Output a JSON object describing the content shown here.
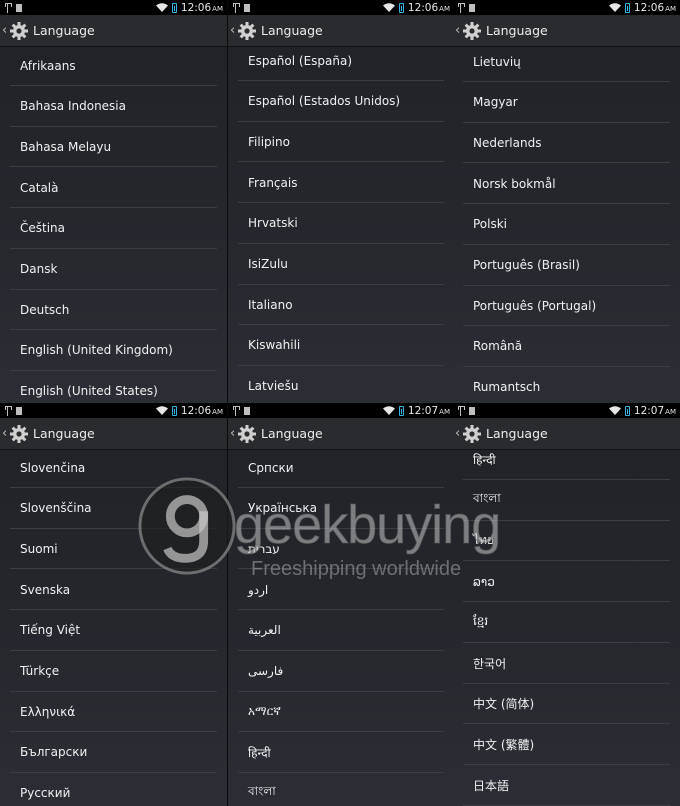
{
  "colors": {
    "accent": "#33b5e5",
    "background": "#24282d",
    "divider": "#3a3e43",
    "text": "#f0f0f0"
  },
  "panels": [
    {
      "time": "12:06",
      "ampm": "AM",
      "title": "Language",
      "items": [
        "Afrikaans",
        "Bahasa Indonesia",
        "Bahasa Melayu",
        "Català",
        "Čeština",
        "Dansk",
        "Deutsch",
        "English (United Kingdom)",
        "English (United States)"
      ]
    },
    {
      "time": "12:06",
      "ampm": "AM",
      "title": "Language",
      "items": [
        "Español (España)",
        "Español (Estados Unidos)",
        "Filipino",
        "Français",
        "Hrvatski",
        "IsiZulu",
        "Italiano",
        "Kiswahili",
        "Latviešu"
      ]
    },
    {
      "time": "12:06",
      "ampm": "AM",
      "title": "Language",
      "items": [
        "Lietuvių",
        "Magyar",
        "Nederlands",
        "Norsk bokmål",
        "Polski",
        "Português (Brasil)",
        "Português (Portugal)",
        "Română",
        "Rumantsch"
      ]
    },
    {
      "time": "12:06",
      "ampm": "AM",
      "title": "Language",
      "items": [
        "Slovenčina",
        "Slovenščina",
        "Suomi",
        "Svenska",
        "Tiếng Việt",
        "Türkçe",
        "Ελληνικά",
        "Български",
        "Русский"
      ]
    },
    {
      "time": "12:07",
      "ampm": "AM",
      "title": "Language",
      "items": [
        "Српски",
        "Українська",
        "עברית",
        "اردو",
        "العربية",
        "فارسی",
        "አማርኛ",
        "हिन्दी",
        "বাংলা"
      ]
    },
    {
      "time": "12:07",
      "ampm": "AM",
      "title": "Language",
      "items": [
        "हिन्दी",
        "বাংলা",
        "ไทย",
        "ລາວ",
        "ខ្មែរ",
        "한국어",
        "中文 (简体)",
        "中文 (繁體)",
        "日本語"
      ]
    }
  ],
  "watermark": {
    "brand": "geekbuying",
    "tagline": "Freeshipping worldwide"
  }
}
